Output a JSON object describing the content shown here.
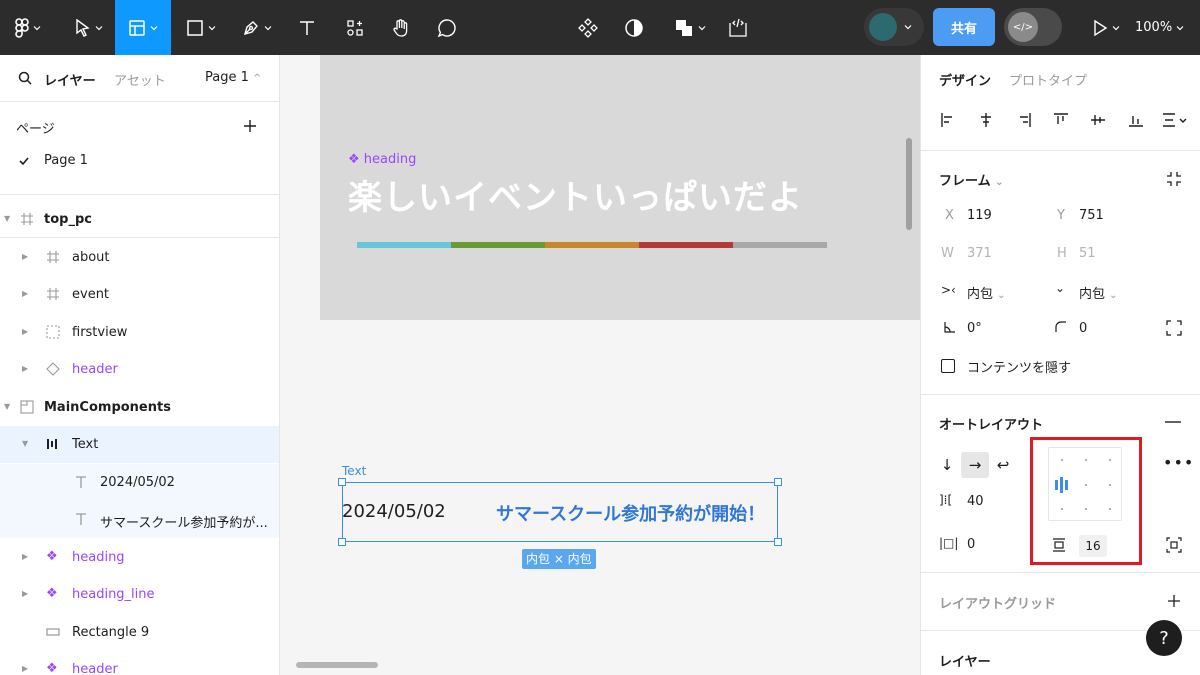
{
  "toolbar": {
    "share_label": "共有",
    "zoom_label": "100%"
  },
  "left_panel": {
    "tab_layers": "レイヤー",
    "tab_assets": "アセット",
    "page_selector": "Page 1",
    "pages_title": "ページ",
    "pages": [
      {
        "label": "Page 1",
        "checked": true
      }
    ],
    "layers": [
      {
        "label": "top_pc",
        "icon": "frame-icon"
      },
      {
        "label": "about",
        "icon": "frame-icon"
      },
      {
        "label": "event",
        "icon": "frame-icon"
      },
      {
        "label": "firstview",
        "icon": "section-icon"
      },
      {
        "label": "header",
        "icon": "instance-icon"
      },
      {
        "label": "MainComponents",
        "icon": "section-icon"
      },
      {
        "label": "Text",
        "icon": "auto-layout-icon"
      },
      {
        "label": "2024/05/02",
        "icon": "text-icon"
      },
      {
        "label": "サマースクール参加予約が...",
        "icon": "text-icon"
      },
      {
        "label": "heading",
        "icon": "component-icon"
      },
      {
        "label": "heading_line",
        "icon": "component-icon"
      },
      {
        "label": "Rectangle 9",
        "icon": "rectangle-icon"
      },
      {
        "label": "header",
        "icon": "component-icon"
      }
    ]
  },
  "canvas": {
    "heading_tag": "❖ heading",
    "heading_text": "楽しいイベントいっぱいだよ",
    "line_colors": [
      "#6bc5d9",
      "#6a9a35",
      "#c8872b",
      "#b33a3a",
      "#a8a8a8"
    ],
    "text_frame_label": "Text",
    "date_text": "2024/05/02",
    "notice_text": "サマースクール参加予約が開始！",
    "size_badge": "内包 × 内包"
  },
  "right_panel": {
    "tab_design": "デザイン",
    "tab_prototype": "プロトタイプ",
    "frame_title": "フレーム",
    "x_label": "X",
    "x_value": "119",
    "y_label": "Y",
    "y_value": "751",
    "w_label": "W",
    "w_value": "371",
    "h_label": "H",
    "h_value": "51",
    "width_mode": "内包",
    "height_mode": "内包",
    "rotation": "0°",
    "radius": "0",
    "clip_content": "コンテンツを隠す",
    "auto_layout_title": "オートレイアウト",
    "gap_value": "40",
    "padding_h": "0",
    "padding_v": "16",
    "layout_grid_title": "レイアウトグリッド",
    "layer_title": "レイヤー",
    "help": "?"
  }
}
